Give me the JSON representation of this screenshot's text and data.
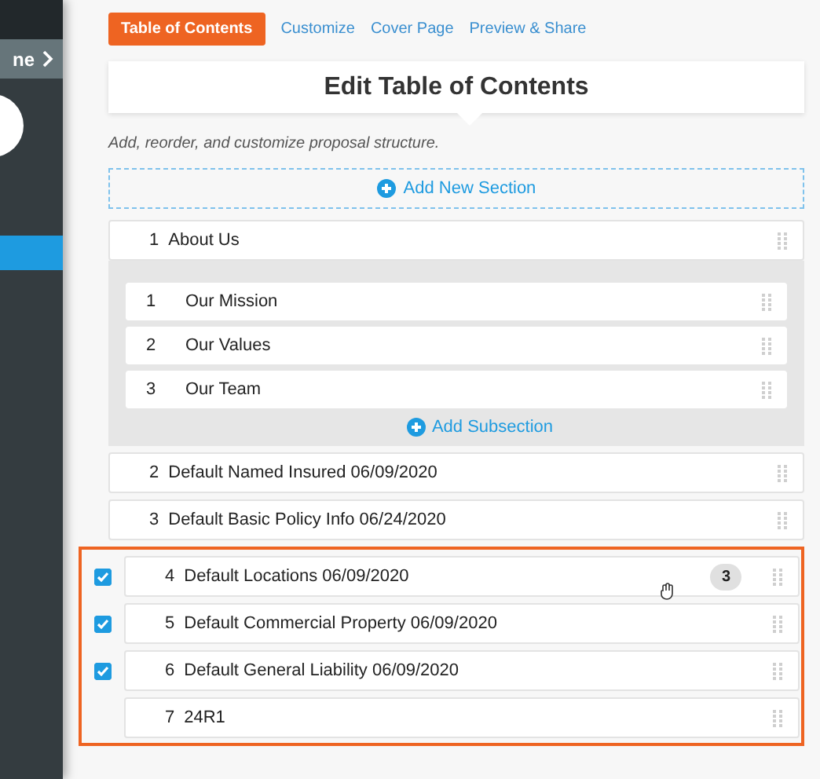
{
  "sidebar": {
    "header_label": "ne",
    "items": [
      {
        "selected": true
      }
    ]
  },
  "tabs": [
    {
      "label": "Table of Contents",
      "selected": true
    },
    {
      "label": "Customize",
      "selected": false
    },
    {
      "label": "Cover Page",
      "selected": false
    },
    {
      "label": "Preview & Share",
      "selected": false
    }
  ],
  "title": "Edit Table of Contents",
  "description": "Add, reorder, and customize proposal structure.",
  "add_section": "Add New Section",
  "sections": [
    {
      "number": "1",
      "title": "About Us",
      "checked": false,
      "highlighted": false,
      "expanded": true,
      "add_subsection": "Add Subsection",
      "children": [
        {
          "number": "1",
          "title": "Our Mission"
        },
        {
          "number": "2",
          "title": "Our Values"
        },
        {
          "number": "3",
          "title": "Our Team"
        }
      ]
    },
    {
      "number": "2",
      "title": "Default Named Insured 06/09/2020",
      "checked": false,
      "highlighted": false
    },
    {
      "number": "3",
      "title": "Default Basic Policy Info 06/24/2020",
      "checked": false,
      "highlighted": false
    },
    {
      "number": "4",
      "title": "Default Locations 06/09/2020",
      "checked": true,
      "highlighted": true,
      "badge": "3",
      "hovered": true
    },
    {
      "number": "5",
      "title": "Default Commercial Property 06/09/2020",
      "checked": true,
      "highlighted": true
    },
    {
      "number": "6",
      "title": "Default General Liability 06/09/2020",
      "checked": true,
      "highlighted": true
    },
    {
      "number": "7",
      "title": "24R1",
      "checked": false,
      "highlighted": true
    }
  ]
}
